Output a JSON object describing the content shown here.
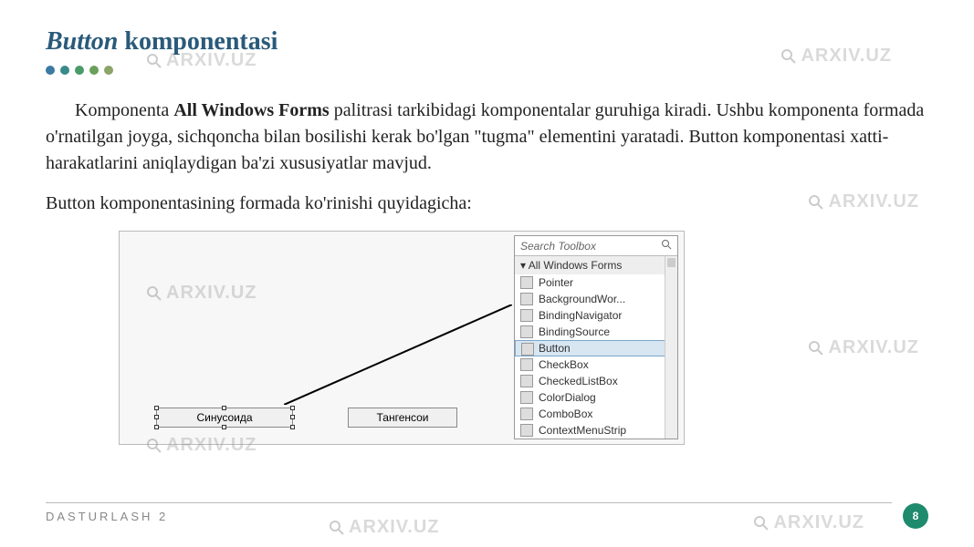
{
  "title": {
    "italic": "Button",
    "rest": " komponentasi"
  },
  "dot_colors": [
    "#3b7aa3",
    "#3b8a8a",
    "#4a9a6a",
    "#6aa05a",
    "#8aa566"
  ],
  "paragraph": {
    "pre": "Komponenta ",
    "bold": "All Windows Forms",
    "post": " palitrasi tarkibidagi komponentalar guruhiga kiradi. Ushbu komponenta formada o'rnatilgan joyga, sichqoncha bilan bosilishi kerak bo'lgan \"tugma\" elementini yaratadi. Button komponentasi xatti-harakatlarini aniqlaydigan ba'zi xususiyatlar mavjud."
  },
  "paragraph2": "Button komponentasining formada ko'rinishi quyidagicha:",
  "toolbox": {
    "search_placeholder": "Search Toolbox",
    "group": "All Windows Forms",
    "items": [
      "Pointer",
      "BackgroundWor...",
      "BindingNavigator",
      "BindingSource",
      "Button",
      "CheckBox",
      "CheckedListBox",
      "ColorDialog",
      "ComboBox",
      "ContextMenuStrip"
    ],
    "selected_index": 4
  },
  "form_buttons": {
    "btn1": "Синусоида",
    "btn2": "Тангенсои"
  },
  "footer": {
    "text": "DASTURLASH 2",
    "page": "8"
  },
  "watermark_text": "ARXIV.UZ"
}
